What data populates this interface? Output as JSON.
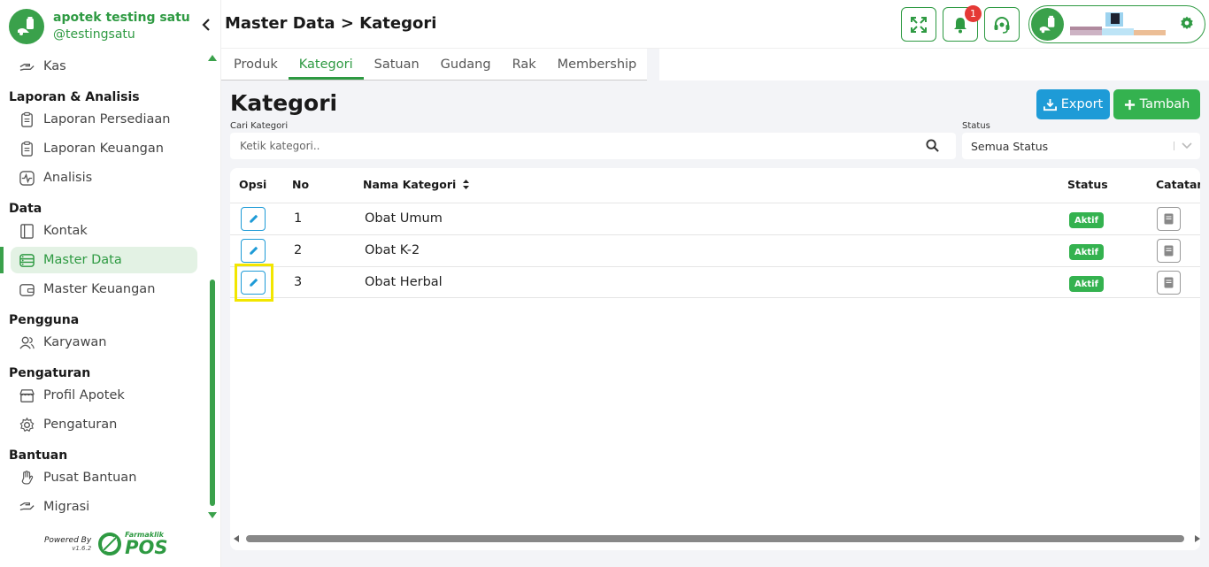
{
  "app": {
    "name": "apotek testing satu",
    "handle": "@testingsatu"
  },
  "header": {
    "title": "Master Data > Kategori",
    "notification_count": "1"
  },
  "sidebar": {
    "partial_item": "Kas",
    "sections": [
      {
        "title": "Laporan & Analisis",
        "items": [
          "Laporan Persediaan",
          "Laporan Keuangan",
          "Analisis"
        ]
      },
      {
        "title": "Data",
        "items": [
          "Kontak",
          "Master Data",
          "Master Keuangan"
        ]
      },
      {
        "title": "Pengguna",
        "items": [
          "Karyawan"
        ]
      },
      {
        "title": "Pengaturan",
        "items": [
          "Profil Apotek",
          "Pengaturan"
        ]
      },
      {
        "title": "Bantuan",
        "items": [
          "Pusat Bantuan",
          "Migrasi"
        ]
      }
    ],
    "active_item": "Master Data"
  },
  "footer": {
    "powered_by": "Powered By",
    "version": "v1.6.2",
    "brand_small": "Farmaklik",
    "brand_big": "POS"
  },
  "tabs": [
    "Produk",
    "Kategori",
    "Satuan",
    "Gudang",
    "Rak",
    "Membership"
  ],
  "active_tab": "Kategori",
  "content": {
    "title": "Kategori",
    "export_label": "Export",
    "add_label": "Tambah",
    "search_label": "Cari Kategori",
    "search_placeholder": "Ketik kategori..",
    "status_label": "Status",
    "status_value": "Semua Status"
  },
  "table": {
    "columns": {
      "opsi": "Opsi",
      "no": "No",
      "name": "Nama Kategori",
      "status": "Status",
      "note": "Catatan"
    },
    "rows": [
      {
        "no": "1",
        "name": "Obat Umum",
        "status": "Aktif"
      },
      {
        "no": "2",
        "name": "Obat K-2",
        "status": "Aktif"
      },
      {
        "no": "3",
        "name": "Obat Herbal",
        "status": "Aktif"
      }
    ]
  },
  "colors": {
    "brand_green": "#3aa14b",
    "export_blue": "#1e9bd7",
    "add_green": "#34b24f",
    "badge_red": "#e53935",
    "highlight_yellow": "#f2e600"
  },
  "icons": {
    "fullscreen": "fullscreen-icon",
    "notification": "bell-icon",
    "support": "headset-icon",
    "settings": "gear-icon",
    "search": "search-icon",
    "edit": "pencil-icon",
    "note": "note-icon",
    "sort": "sort-icon"
  }
}
